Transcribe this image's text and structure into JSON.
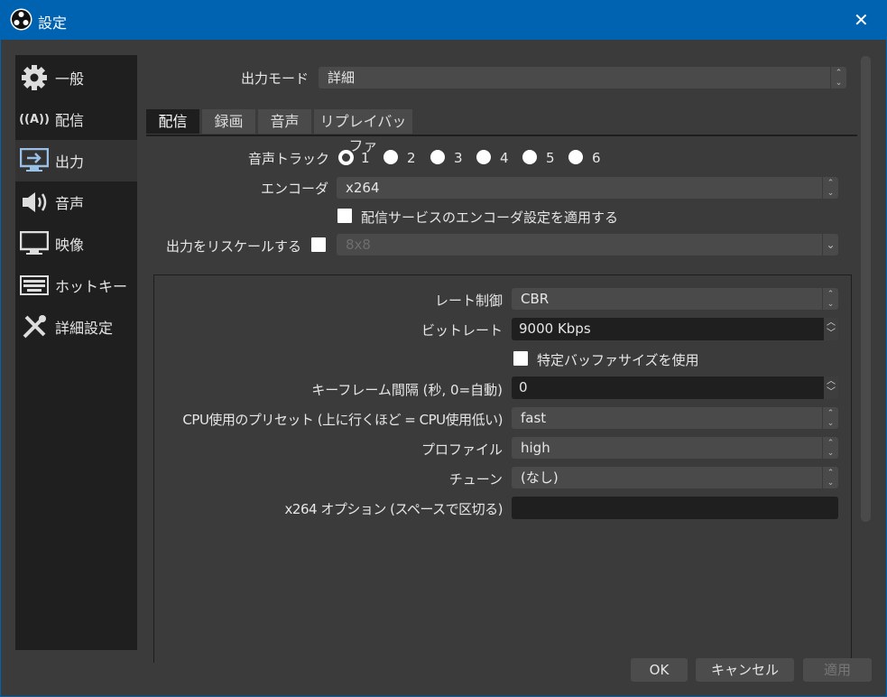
{
  "window": {
    "title": "設定",
    "close": "✕"
  },
  "sidebar": {
    "items": [
      {
        "label": "一般"
      },
      {
        "label": "配信"
      },
      {
        "label": "出力"
      },
      {
        "label": "音声"
      },
      {
        "label": "映像"
      },
      {
        "label": "ホットキー"
      },
      {
        "label": "詳細設定"
      }
    ]
  },
  "output_mode": {
    "label": "出力モード",
    "value": "詳細"
  },
  "tabs": [
    {
      "label": "配信"
    },
    {
      "label": "録画"
    },
    {
      "label": "音声"
    },
    {
      "label": "リプレイバッファ"
    }
  ],
  "streaming": {
    "audio_track_label": "音声トラック",
    "tracks": [
      "1",
      "2",
      "3",
      "4",
      "5",
      "6"
    ],
    "selected_track": "1",
    "encoder_label": "エンコーダ",
    "encoder": "x264",
    "enforce_label": "配信サービスのエンコーダ設定を適用する",
    "rescale_label": "出力をリスケールする",
    "rescale_value": "8x8",
    "rate_control_label": "レート制御",
    "rate_control": "CBR",
    "bitrate_label": "ビットレート",
    "bitrate": "9000 Kbps",
    "buffer_label": "特定バッファサイズを使用",
    "keyframe_label": "キーフレーム間隔 (秒, 0=自動)",
    "keyframe": "0",
    "preset_label": "CPU使用のプリセット (上に行くほど = CPU使用低い)",
    "preset": "fast",
    "profile_label": "プロファイル",
    "profile": "high",
    "tune_label": "チューン",
    "tune": "(なし)",
    "options_label": "x264 オプション (スペースで区切る)",
    "options": ""
  },
  "buttons": {
    "ok": "OK",
    "cancel": "キャンセル",
    "apply": "適用"
  }
}
